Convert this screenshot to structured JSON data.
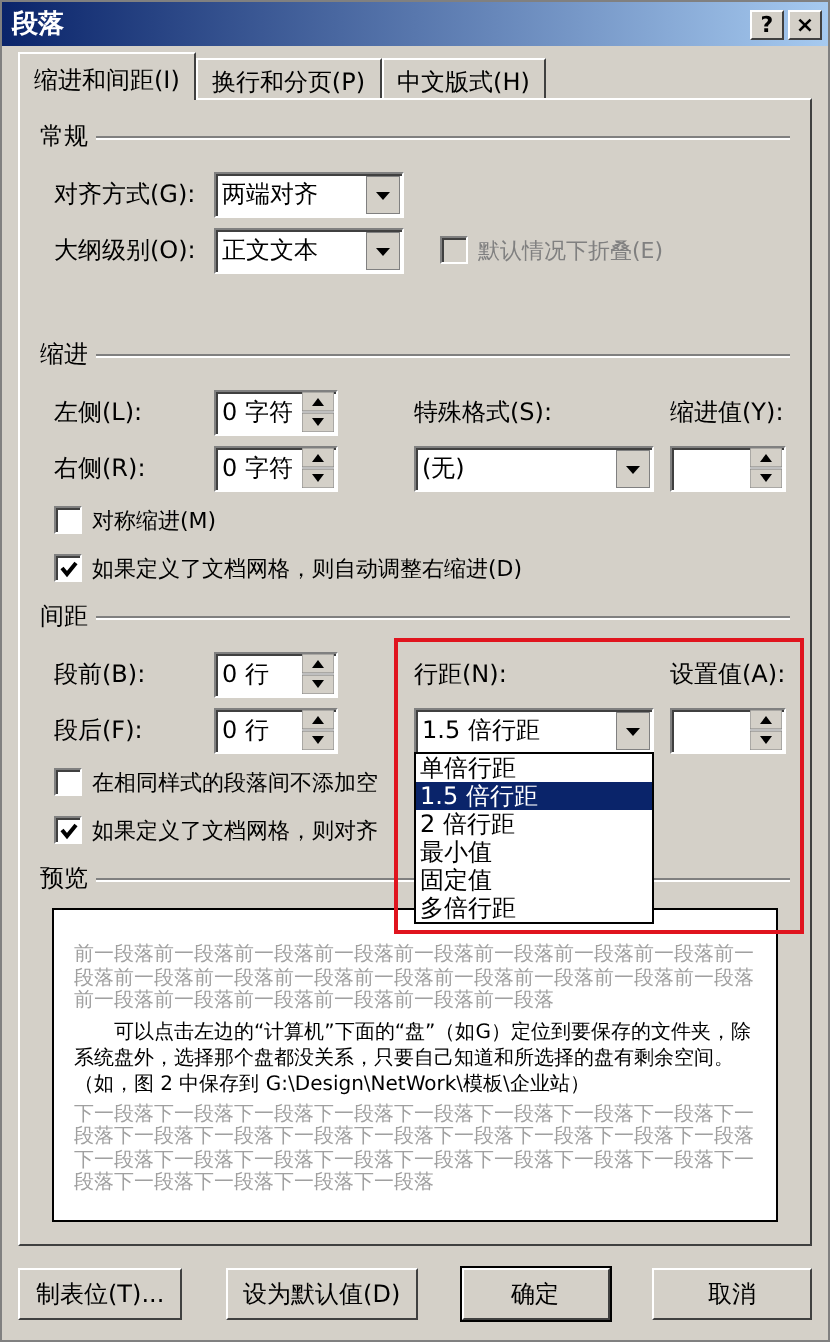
{
  "window": {
    "title": "段落",
    "title_buttons": [
      "?",
      "×"
    ]
  },
  "tabs": [
    {
      "label": "缩进和间距(I)",
      "selected": true
    },
    {
      "label": "换行和分页(P)",
      "selected": false
    },
    {
      "label": "中文版式(H)",
      "selected": false
    }
  ],
  "general": {
    "title": "常规",
    "alignment": {
      "label": "对齐方式(G):",
      "value": "两端对齐"
    },
    "outline_level": {
      "label": "大纲级别(O):",
      "value": "正文文本"
    },
    "collapse": {
      "label": "默认情况下折叠(E)",
      "checked": false,
      "disabled": true
    }
  },
  "indent": {
    "title": "缩进",
    "left": {
      "label": "左侧(L):",
      "value": "0 字符"
    },
    "right": {
      "label": "右侧(R):",
      "value": "0 字符"
    },
    "special": {
      "label": "特殊格式(S):",
      "value": "(无)"
    },
    "by": {
      "label": "缩进值(Y):"
    },
    "checkboxes": [
      {
        "label": "对称缩进(M)",
        "checked": false
      },
      {
        "label": "如果定义了文档网格，则自动调整右缩进(D)",
        "checked": true
      }
    ]
  },
  "spacing": {
    "title": "间距",
    "before": {
      "label": "段前(B):",
      "value": "0 行"
    },
    "after": {
      "label": "段后(F):",
      "value": "0 行"
    },
    "line_spacing": {
      "label": "行距(N):",
      "value": "1.5 倍行距",
      "expanded": true,
      "options": [
        {
          "label": "单倍行距",
          "selected": false
        },
        {
          "label": "1.5 倍行距",
          "selected": true
        },
        {
          "label": "2 倍行距",
          "selected": false
        },
        {
          "label": "最小值",
          "selected": false
        },
        {
          "label": "固定值",
          "selected": false
        },
        {
          "label": "多倍行距",
          "selected": false
        }
      ]
    },
    "at": {
      "label": "设置值(A):"
    },
    "checkboxes": [
      {
        "label": "在相同样式的段落间不添加空",
        "checked": false
      },
      {
        "label": "如果定义了文档网格，则对齐",
        "checked": true
      }
    ]
  },
  "preview": {
    "title": "预览",
    "previous_text": "前一段落前一段落前一段落前一段落前一段落前一段落前一段落前一段落前一段落前一段落前一段落前一段落前一段落前一段落前一段落前一段落前一段落前一段落前一段落前一段落前一段落前一段落前一段落",
    "text": "可以点击左边的“计算机”下面的“盘”（如G）定位到要保存的文件夹，除系统盘外，选择那个盘都没关系，只要自己知道和所选择的盘有剩余空间。（如，图 2 中保存到 G:\\Design\\NetWork\\模板\\企业站）",
    "next_text": "下一段落下一段落下一段落下一段落下一段落下一段落下一段落下一段落下一段落下一段落下一段落下一段落下一段落下一段落下一段落下一段落下一段落下一段落下一段落下一段落下一段落下一段落下一段落下一段落下一段落下一段落下一段落下一段落下一段落下一段落"
  },
  "buttons": [
    {
      "label": "制表位(T)...",
      "default": false
    },
    {
      "label": "设为默认值(D)",
      "default": false
    },
    {
      "label": "确定",
      "default": true
    },
    {
      "label": "取消",
      "default": false
    }
  ]
}
